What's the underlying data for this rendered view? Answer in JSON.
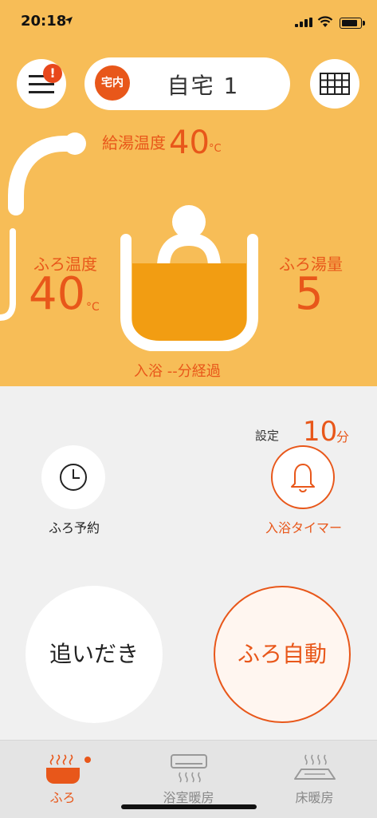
{
  "status": {
    "time": "20:18"
  },
  "header": {
    "home_tag": "宅内",
    "home_name": "自宅 1",
    "alert_badge": "!"
  },
  "colors": {
    "accent": "#e8571a",
    "top_background": "#f7bd57",
    "bath_water": "#f29d12"
  },
  "feed_water": {
    "label": "給湯温度",
    "value": "40",
    "unit": "°C"
  },
  "bath_temp": {
    "label": "ふろ温度",
    "value": "40",
    "unit": "°C"
  },
  "bath_volume": {
    "label": "ふろ湯量",
    "value": "5"
  },
  "elapsed": {
    "text": "入浴 --分経過"
  },
  "timer_setting": {
    "label": "設定",
    "value": "10",
    "unit": "分"
  },
  "controls": {
    "reserve_label": "ふろ予約",
    "timer_label": "入浴タイマー",
    "reheat_label": "追いだき",
    "auto_label": "ふろ自動"
  },
  "tabs": [
    {
      "label": "ふろ",
      "icon": "bath-icon",
      "active": true
    },
    {
      "label": "浴室暖房",
      "icon": "room-heater-icon",
      "active": false
    },
    {
      "label": "床暖房",
      "icon": "floor-heater-icon",
      "active": false
    }
  ]
}
